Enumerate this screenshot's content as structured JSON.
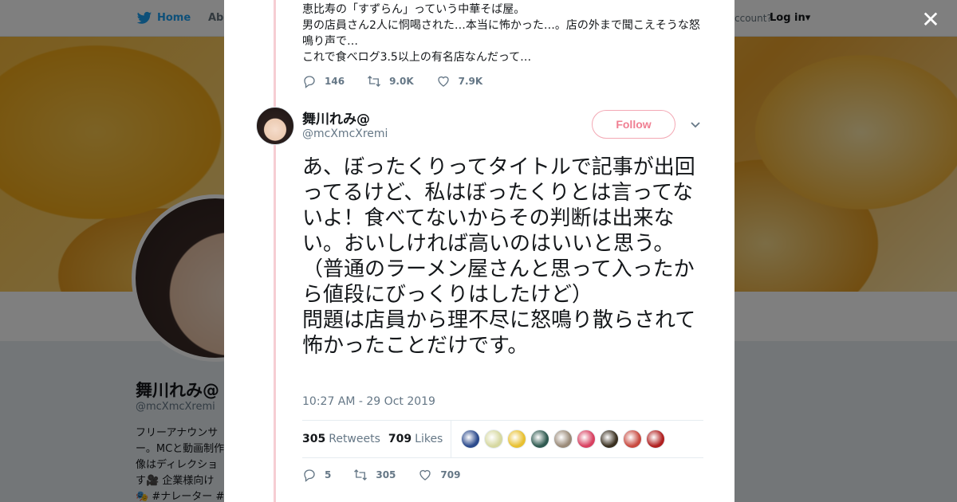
{
  "background": {
    "nav": {
      "home_label": "Home",
      "about_label": "Abo",
      "account_text": "ccount?",
      "login_label": "Log in"
    },
    "profile": {
      "name": "舞川れみ@",
      "handle": "@mcXmcXremi",
      "bio": "フリーアナウンサ\nー。MCと動画制作\n像はディレクショ\nす🎥 企業様向け\n🎭 #ナレーター #"
    }
  },
  "modal": {
    "close_label": "✕",
    "previous_tweet": {
      "text": "恵比寿の「すずらん」っていう中華そば屋。\n男の店員さん2人に恫喝された…本当に怖かった…。店の外まで聞こえそうな怒鳴り声で…\nこれで食べログ3.5以上の有名店なんだって…",
      "replies": "146",
      "retweets": "9.0K",
      "likes": "7.9K"
    },
    "tweet": {
      "author_name": "舞川れみ@",
      "author_handle": "@mcXmcXremi",
      "follow_label": "Follow",
      "text": "あ、ぼったくりってタイトルで記事が出回ってるけど、私はぼったくりとは言ってないよ！食べてないからその判断は出来ない。おいしければ高いのはいいと思う。\n（普通のラーメン屋さんと思って入ったから値段にびっくりはしたけど）\n問題は店員から理不尽に怒鳴り散らされて怖かったことだけです。",
      "timestamp": "10:27 AM - 29 Oct 2019",
      "retweet_count": "305",
      "retweet_label": "Retweets",
      "like_count": "709",
      "like_label": "Likes",
      "replies": "5",
      "retweets": "305",
      "likes": "709"
    }
  },
  "colors": {
    "twitter_blue": "#1da1f2",
    "thread_line": "#f6cdd3",
    "follow_accent": "#f07f92",
    "face_colors": [
      "#2b4a8c",
      "#d6d8a0",
      "#e8c030",
      "#2f5a50",
      "#9a8a78",
      "#d84060",
      "#3a3020",
      "#c84a40",
      "#b02020"
    ]
  }
}
